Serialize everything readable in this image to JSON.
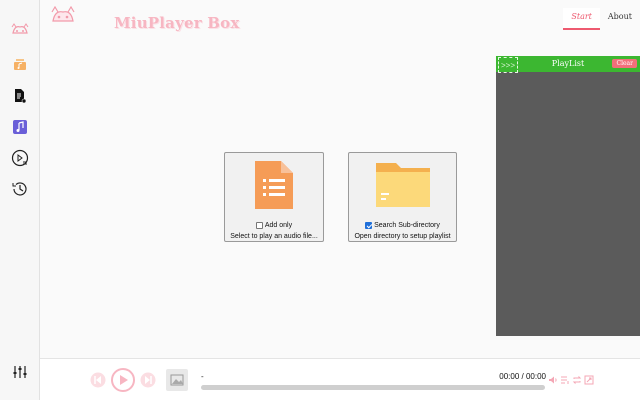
{
  "app": {
    "title": "MiuPlayer Box"
  },
  "nav": {
    "tabs": [
      {
        "label": "Start",
        "active": true
      },
      {
        "label": "About",
        "active": false
      }
    ]
  },
  "sidebar": {
    "items": [
      {
        "name": "logo-icon"
      },
      {
        "name": "playlist-music-icon"
      },
      {
        "name": "audio-file-icon"
      },
      {
        "name": "music-note-icon"
      },
      {
        "name": "play-list-icon"
      },
      {
        "name": "history-icon"
      },
      {
        "name": "equalizer-icon"
      }
    ]
  },
  "cards": {
    "file": {
      "checkbox_label": "Add only",
      "checked": false,
      "action": "Select to play an audio file..."
    },
    "folder": {
      "checkbox_label": "Search Sub-directory",
      "checked": true,
      "action": "Open directory to setup playlist"
    }
  },
  "playlist": {
    "title": "PlayList",
    "toggle": ">>>",
    "clear_label": "Clear"
  },
  "player": {
    "track_name": "-",
    "time": "00:00 / 00:00",
    "progress": 0
  },
  "colors": {
    "accent": "#ee5a70",
    "playlist_header": "#3cb731",
    "playlist_bg": "#5b5b5b",
    "file_icon": "#f59c57",
    "folder_icon": "#fbd46d"
  }
}
